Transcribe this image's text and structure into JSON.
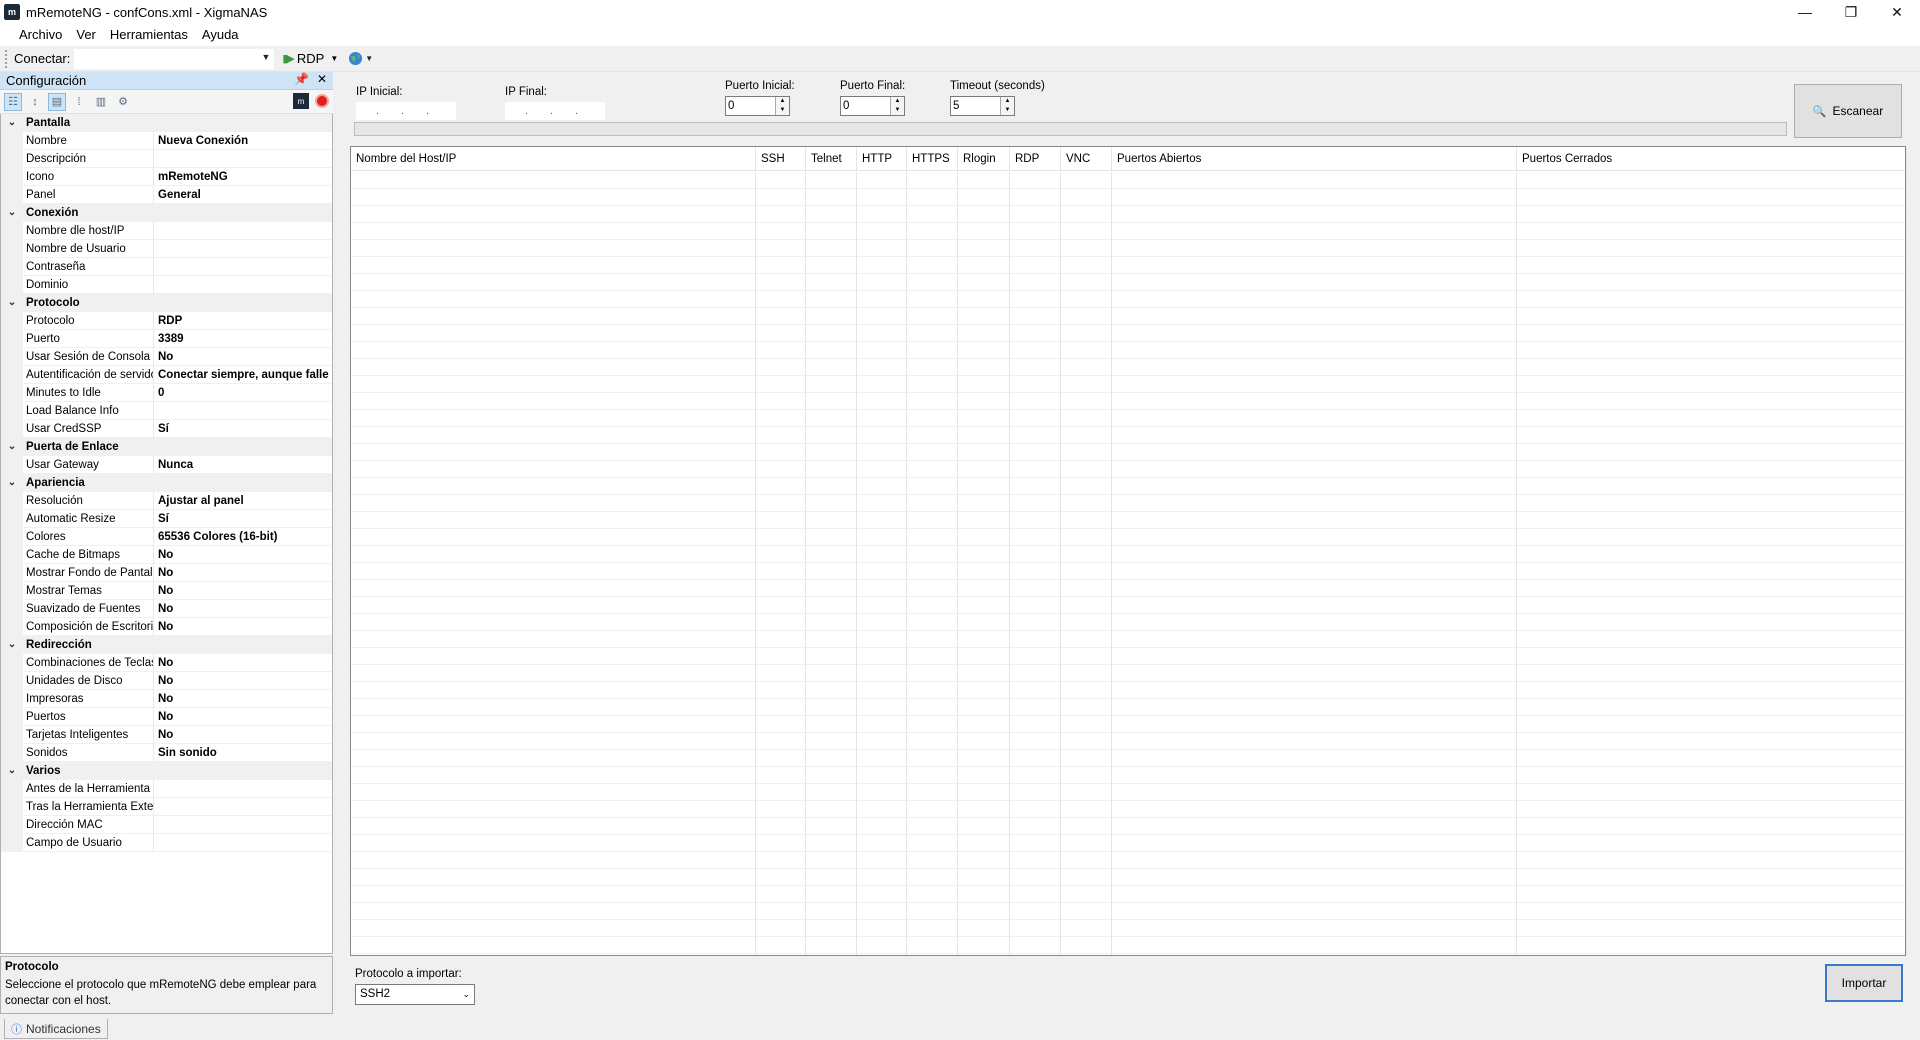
{
  "window": {
    "title": "mRemoteNG - confCons.xml - XigmaNAS",
    "minimize": "—",
    "restore": "❐",
    "close": "✕"
  },
  "menu": [
    "Archivo",
    "Ver",
    "Herramientas",
    "Ayuda"
  ],
  "toolbar": {
    "connect_label": "Conectar:",
    "connect_value": "",
    "protocol": "RDP"
  },
  "config_panel": {
    "title": "Configuración",
    "categories": [
      {
        "name": "Pantalla",
        "rows": [
          {
            "label": "Nombre",
            "value": "Nueva Conexión"
          },
          {
            "label": "Descripción",
            "value": ""
          },
          {
            "label": "Icono",
            "value": "mRemoteNG"
          },
          {
            "label": "Panel",
            "value": "General"
          }
        ]
      },
      {
        "name": "Conexión",
        "rows": [
          {
            "label": "Nombre dle host/IP",
            "value": ""
          },
          {
            "label": "Nombre de Usuario",
            "value": ""
          },
          {
            "label": "Contraseña",
            "value": ""
          },
          {
            "label": "Dominio",
            "value": ""
          }
        ]
      },
      {
        "name": "Protocolo",
        "rows": [
          {
            "label": "Protocolo",
            "value": "RDP"
          },
          {
            "label": "Puerto",
            "value": "3389"
          },
          {
            "label": "Usar Sesión de Consola",
            "value": "No"
          },
          {
            "label": "Autentificación de servido",
            "value": "Conectar siempre, aunque falle la"
          },
          {
            "label": "Minutes to Idle",
            "value": "0"
          },
          {
            "label": "Load Balance Info",
            "value": ""
          },
          {
            "label": "Usar CredSSP",
            "value": "Sí"
          }
        ]
      },
      {
        "name": "Puerta de Enlace",
        "rows": [
          {
            "label": "Usar Gateway",
            "value": "Nunca"
          }
        ]
      },
      {
        "name": "Apariencia",
        "rows": [
          {
            "label": "Resolución",
            "value": "Ajustar al panel"
          },
          {
            "label": "Automatic Resize",
            "value": "Sí"
          },
          {
            "label": "Colores",
            "value": "65536 Colores (16-bit)"
          },
          {
            "label": "Cache de Bitmaps",
            "value": "No"
          },
          {
            "label": "Mostrar Fondo de Pantall",
            "value": "No"
          },
          {
            "label": "Mostrar Temas",
            "value": "No"
          },
          {
            "label": "Suavizado de Fuentes",
            "value": "No"
          },
          {
            "label": "Composición de Escritori",
            "value": "No"
          }
        ]
      },
      {
        "name": "Redirección",
        "rows": [
          {
            "label": "Combinaciones de Teclas",
            "value": "No"
          },
          {
            "label": "Unidades de Disco",
            "value": "No"
          },
          {
            "label": "Impresoras",
            "value": "No"
          },
          {
            "label": "Puertos",
            "value": "No"
          },
          {
            "label": "Tarjetas Inteligentes",
            "value": "No"
          },
          {
            "label": "Sonidos",
            "value": "Sin sonido"
          }
        ]
      },
      {
        "name": "Varios",
        "rows": [
          {
            "label": "Antes de la Herramienta E",
            "value": ""
          },
          {
            "label": "Tras la Herramienta Exter",
            "value": ""
          },
          {
            "label": "Dirección MAC",
            "value": ""
          },
          {
            "label": "Campo de Usuario",
            "value": ""
          }
        ]
      }
    ],
    "description_title": "Protocolo",
    "description_text": "Seleccione el protocolo que mRemoteNG debe emplear para conectar con el host."
  },
  "notifications_tab": "Notificaciones",
  "scanner": {
    "ip_start_label": "IP Inicial:",
    "ip_end_label": "IP Final:",
    "port_start_label": "Puerto Inicial:",
    "port_start_value": "0",
    "port_end_label": "Puerto Final:",
    "port_end_value": "0",
    "timeout_label": "Timeout (seconds)",
    "timeout_value": "5",
    "scan_button": "Escanear",
    "progress": 0,
    "columns": [
      "Nombre del Host/IP",
      "SSH",
      "Telnet",
      "HTTP",
      "HTTPS",
      "Rlogin",
      "RDP",
      "VNC",
      "Puertos Abiertos",
      "Puertos Cerrados"
    ],
    "import_label": "Protocolo a importar:",
    "import_value": "SSH2",
    "import_button": "Importar"
  }
}
